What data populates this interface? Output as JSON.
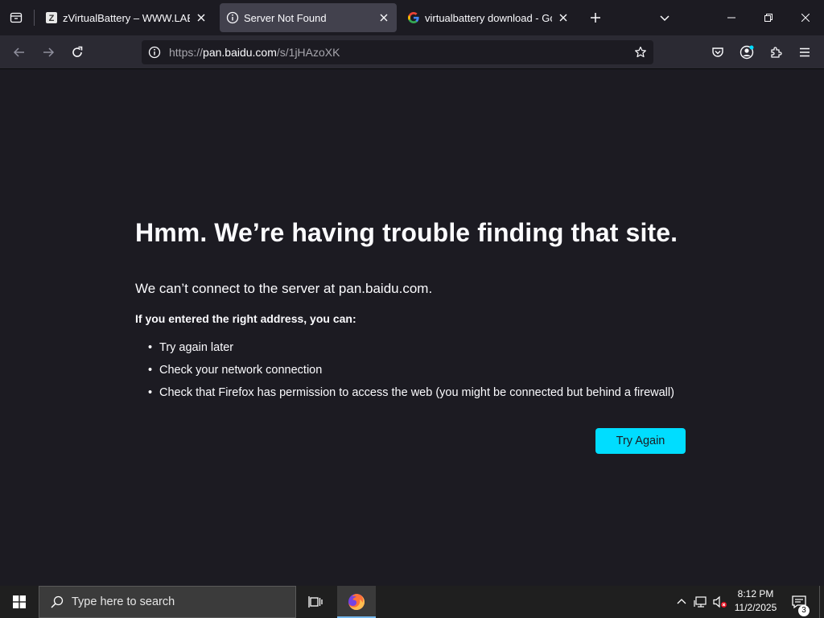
{
  "tabs": [
    {
      "label": "zVirtualBattery – WWW.LAB-Z.C",
      "icon": "lab-z-favicon-icon",
      "active": false
    },
    {
      "label": "Server Not Found",
      "icon": "info-icon",
      "active": true
    },
    {
      "label": "virtualbattery download - Goog",
      "icon": "google-favicon-icon",
      "active": false
    }
  ],
  "navbar": {
    "url_prefix": "https://",
    "url_host": "pan.baidu.com",
    "url_path": "/s/1jHAzoXK"
  },
  "error_page": {
    "title": "Hmm. We’re having trouble finding that site.",
    "short_desc": "We can’t connect to the server at pan.baidu.com.",
    "suggestion_heading": "If you entered the right address, you can:",
    "suggestions": [
      "Try again later",
      "Check your network connection",
      "Check that Firefox has permission to access the web (you might be connected but behind a firewall)"
    ],
    "try_again_label": "Try Again"
  },
  "taskbar": {
    "search_placeholder": "Type here to search",
    "time": "8:12 PM",
    "date": "11/2/2025",
    "notification_count": "3"
  },
  "colors": {
    "accent": "#00ddff",
    "background": "#1c1b22",
    "toolbar": "#2b2a33"
  }
}
